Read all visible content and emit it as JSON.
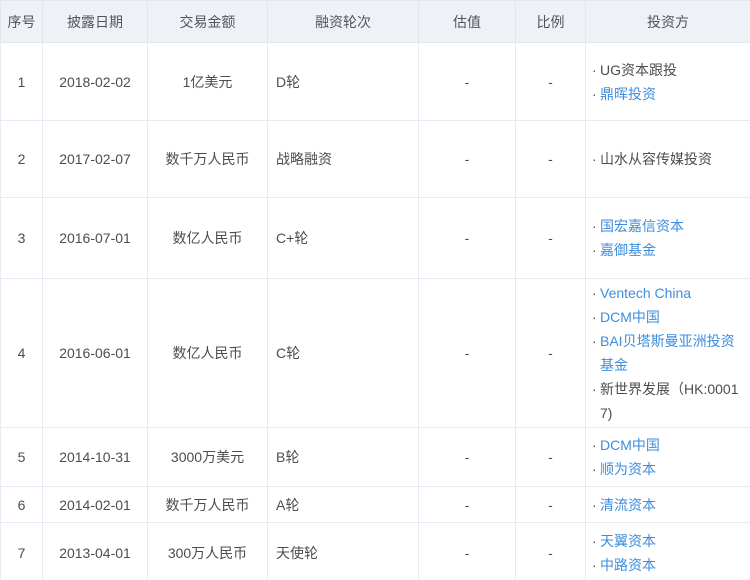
{
  "table": {
    "columns": [
      {
        "key": "index",
        "label": "序号"
      },
      {
        "key": "date",
        "label": "披露日期"
      },
      {
        "key": "amount",
        "label": "交易金额"
      },
      {
        "key": "round",
        "label": "融资轮次"
      },
      {
        "key": "valuation",
        "label": "估值"
      },
      {
        "key": "ratio",
        "label": "比例"
      },
      {
        "key": "investors",
        "label": "投资方"
      }
    ],
    "rows": [
      {
        "index": "1",
        "date": "2018-02-02",
        "amount": "1亿美元",
        "round": "D轮",
        "valuation": "-",
        "ratio": "-",
        "investors": [
          {
            "name": "UG资本跟投",
            "link": false
          },
          {
            "name": "鼎晖投资",
            "link": true
          }
        ]
      },
      {
        "index": "2",
        "date": "2017-02-07",
        "amount": "数千万人民币",
        "round": "战略融资",
        "valuation": "-",
        "ratio": "-",
        "investors": [
          {
            "name": "山水从容传媒投资",
            "link": false
          }
        ]
      },
      {
        "index": "3",
        "date": "2016-07-01",
        "amount": "数亿人民币",
        "round": "C+轮",
        "valuation": "-",
        "ratio": "-",
        "investors": [
          {
            "name": "国宏嘉信资本",
            "link": true
          },
          {
            "name": "嘉御基金",
            "link": true
          }
        ]
      },
      {
        "index": "4",
        "date": "2016-06-01",
        "amount": "数亿人民币",
        "round": "C轮",
        "valuation": "-",
        "ratio": "-",
        "investors": [
          {
            "name": "Ventech China",
            "link": true
          },
          {
            "name": "DCM中国",
            "link": true
          },
          {
            "name": "BAI贝塔斯曼亚洲投资基金",
            "link": true
          },
          {
            "name": "新世界发展（HK:00017)",
            "link": false
          }
        ]
      },
      {
        "index": "5",
        "date": "2014-10-31",
        "amount": "3000万美元",
        "round": "B轮",
        "valuation": "-",
        "ratio": "-",
        "investors": [
          {
            "name": "DCM中国",
            "link": true
          },
          {
            "name": "顺为资本",
            "link": true
          }
        ]
      },
      {
        "index": "6",
        "date": "2014-02-01",
        "amount": "数千万人民币",
        "round": "A轮",
        "valuation": "-",
        "ratio": "-",
        "investors": [
          {
            "name": "清流资本",
            "link": true
          }
        ]
      },
      {
        "index": "7",
        "date": "2013-04-01",
        "amount": "300万人民币",
        "round": "天使轮",
        "valuation": "-",
        "ratio": "-",
        "investors": [
          {
            "name": "天翼资本",
            "link": true
          },
          {
            "name": "中路资本",
            "link": true
          }
        ]
      }
    ]
  },
  "colors": {
    "link_blue": "#3e8ddd",
    "header_bg": "#eef1f6",
    "border": "#e8ecf2",
    "text": "#4d4d4d"
  }
}
